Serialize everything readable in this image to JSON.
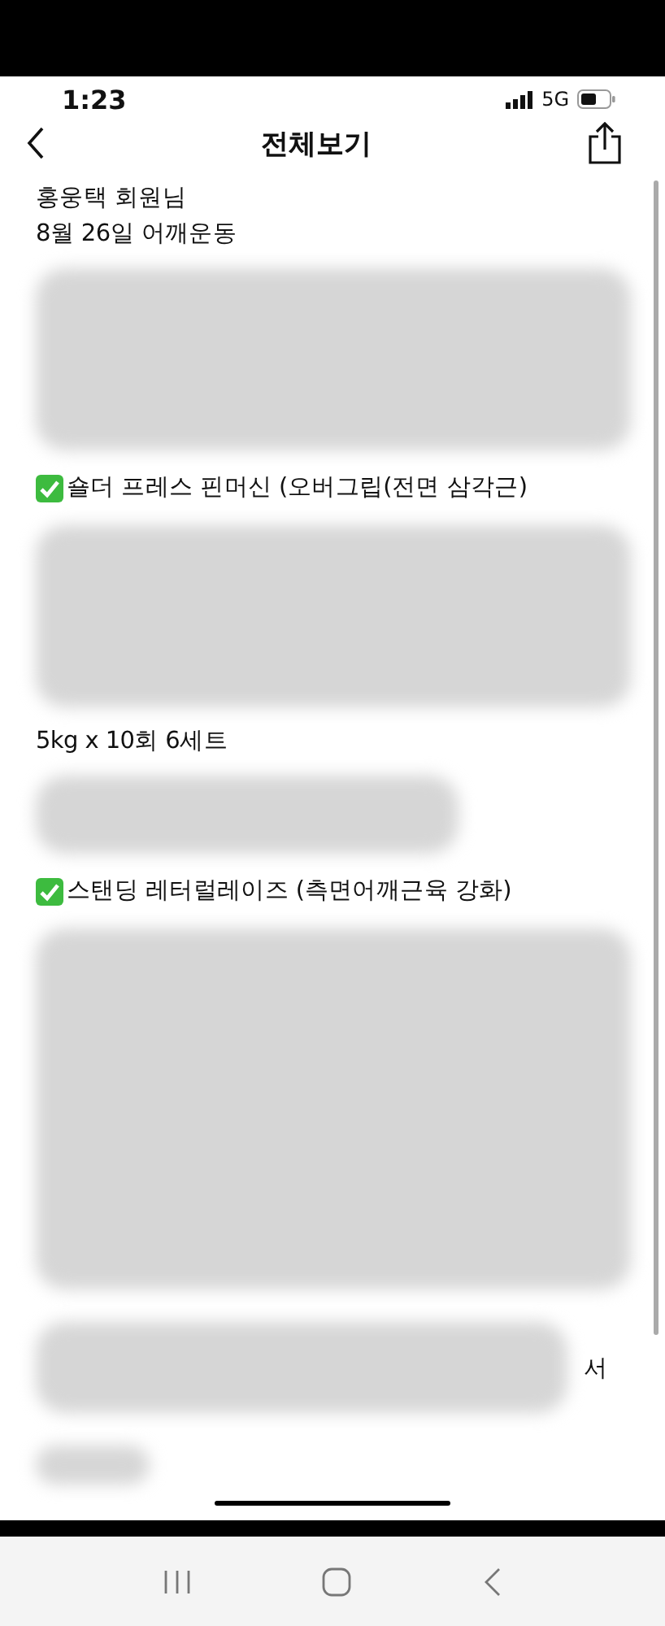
{
  "status_bar": {
    "time": "1:23",
    "network": "5G"
  },
  "header": {
    "title": "전체보기"
  },
  "blocks": [
    {
      "kind": "text",
      "text": "홍웅택 회원님"
    },
    {
      "kind": "text",
      "text": "8월 26일 어깨운동"
    },
    {
      "kind": "blur_large"
    },
    {
      "kind": "check",
      "text": "숄더 프레스 핀머신 (오버그립(전면 삼각근)"
    },
    {
      "kind": "blur_large"
    },
    {
      "kind": "text",
      "text": "5kg x 10회 6세트"
    },
    {
      "kind": "blur_small"
    },
    {
      "kind": "check",
      "text": "스탠딩 레터럴레이즈 (측면어깨근육 강화)"
    },
    {
      "kind": "blur_huge"
    },
    {
      "kind": "blur_medium",
      "trailing_text": "서"
    },
    {
      "kind": "blur_tiny"
    }
  ]
}
